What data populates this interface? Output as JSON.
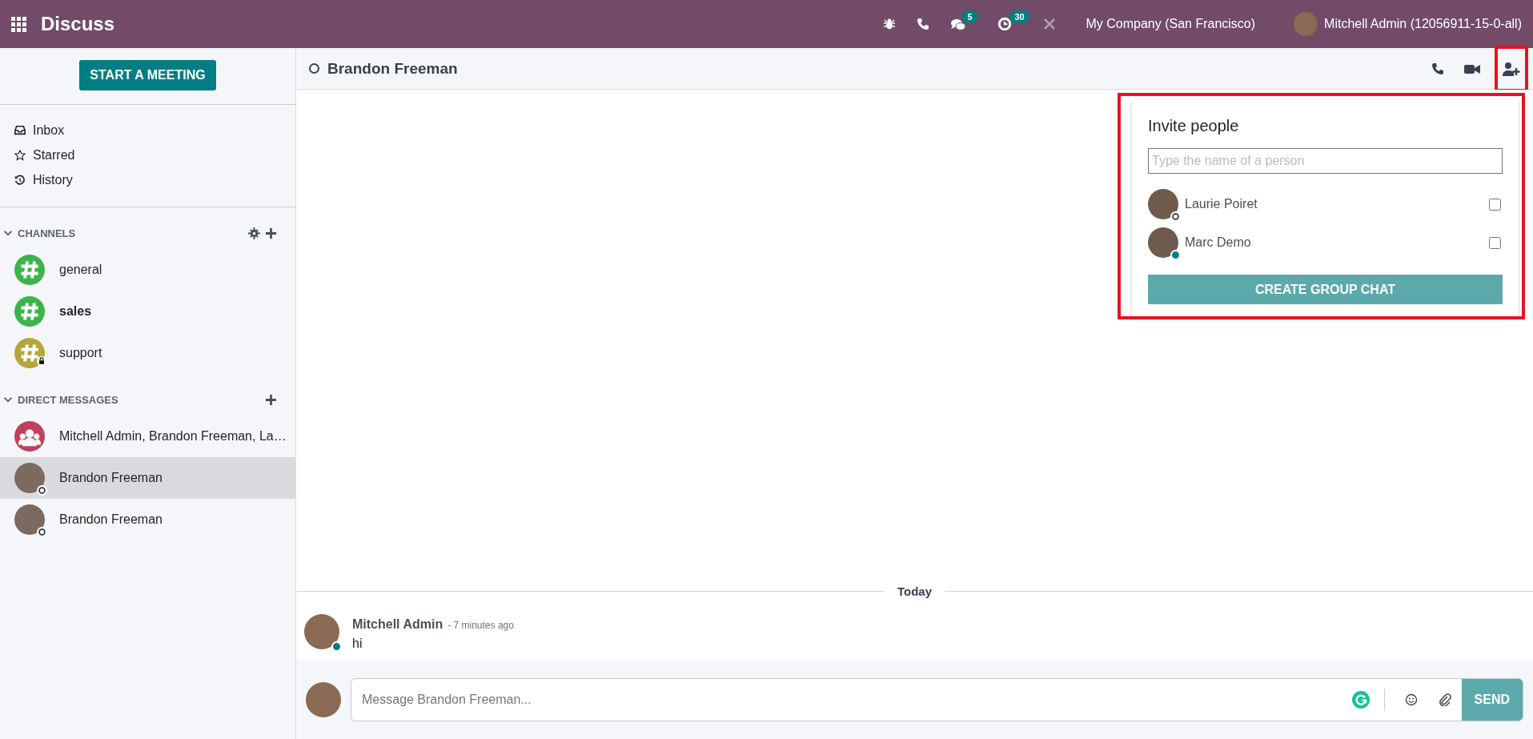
{
  "navbar": {
    "app_title": "Discuss",
    "systray": [
      {
        "kind": "bug"
      },
      {
        "kind": "phone"
      },
      {
        "kind": "chat",
        "count": "5"
      },
      {
        "kind": "clock",
        "count": "30"
      },
      {
        "kind": "tools"
      }
    ],
    "company": "My Company (San Francisco)",
    "user": "Mitchell Admin (12056911-15-0-all)"
  },
  "sidebar": {
    "start_button": "START A MEETING",
    "mailboxes": [
      {
        "kind": "inbox",
        "label": "Inbox"
      },
      {
        "kind": "star",
        "label": "Starred"
      },
      {
        "kind": "history",
        "label": "History"
      }
    ],
    "channels": {
      "title": "CHANNELS",
      "expanded": true,
      "items": [
        {
          "name": "general",
          "color": "#3cb44b",
          "locked": false,
          "unread": false
        },
        {
          "name": "sales",
          "color": "#3cb44b",
          "locked": false,
          "unread": true
        },
        {
          "name": "support",
          "color": "#b5a63a",
          "locked": true,
          "unread": false
        }
      ]
    },
    "direct_messages": {
      "title": "DIRECT MESSAGES",
      "expanded": true,
      "items": [
        {
          "kind": "group",
          "name": "Mitchell Admin, Brandon Freeman, La…",
          "selected": false
        },
        {
          "kind": "person",
          "name": "Brandon Freeman",
          "online": false,
          "selected": true
        },
        {
          "kind": "person",
          "name": "Brandon Freeman",
          "online": false,
          "selected": false
        }
      ]
    }
  },
  "thread": {
    "title": "Brandon Freeman",
    "online": false
  },
  "invite": {
    "title": "Invite people",
    "placeholder": "Type the name of a person",
    "people": [
      {
        "name": "Laurie Poiret",
        "online": false,
        "checked": false
      },
      {
        "name": "Marc Demo",
        "online": true,
        "checked": false
      }
    ],
    "button": "CREATE GROUP CHAT"
  },
  "separator": "Today",
  "messages": [
    {
      "author": "Mitchell Admin",
      "time": "- 7 minutes ago",
      "body": "hi",
      "online": true
    }
  ],
  "composer": {
    "placeholder": "Message Brandon Freeman...",
    "send": "SEND"
  }
}
